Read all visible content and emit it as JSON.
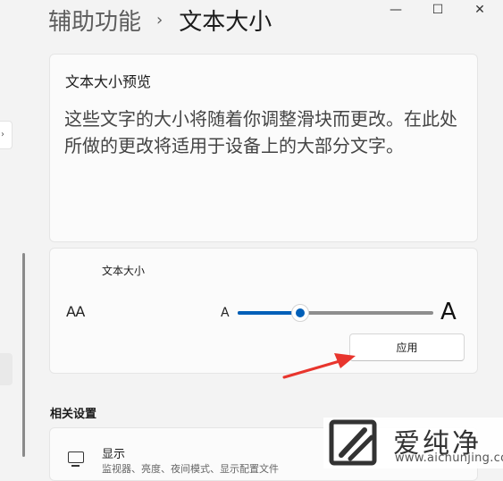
{
  "window": {
    "minimize_glyph": "—",
    "maximize_glyph": "☐",
    "close_glyph": "✕"
  },
  "sidebar": {
    "partial_card_glyph": "›"
  },
  "breadcrumb": {
    "root": "辅助功能",
    "separator": "›",
    "current": "文本大小"
  },
  "preview": {
    "title": "文本大小预览",
    "text": "这些文字的大小将随着你调整滑块而更改。在此处所做的更改将适用于设备上的大部分文字。"
  },
  "text_size": {
    "label": "文本大小",
    "icon_glyph": "AA",
    "slider_min_glyph": "A",
    "slider_max_glyph": "A",
    "slider_value_fraction": 0.32,
    "apply_label": "应用",
    "accent_color": "#005fb8"
  },
  "related": {
    "section_title": "相关设置",
    "display_title": "显示",
    "display_subtitle": "监视器、亮度、夜间模式、显示配置文件"
  },
  "annotation": {
    "arrow_color": "#e8352d"
  },
  "watermark": {
    "name": "爱纯净",
    "url": "www.aichunjing.com"
  }
}
